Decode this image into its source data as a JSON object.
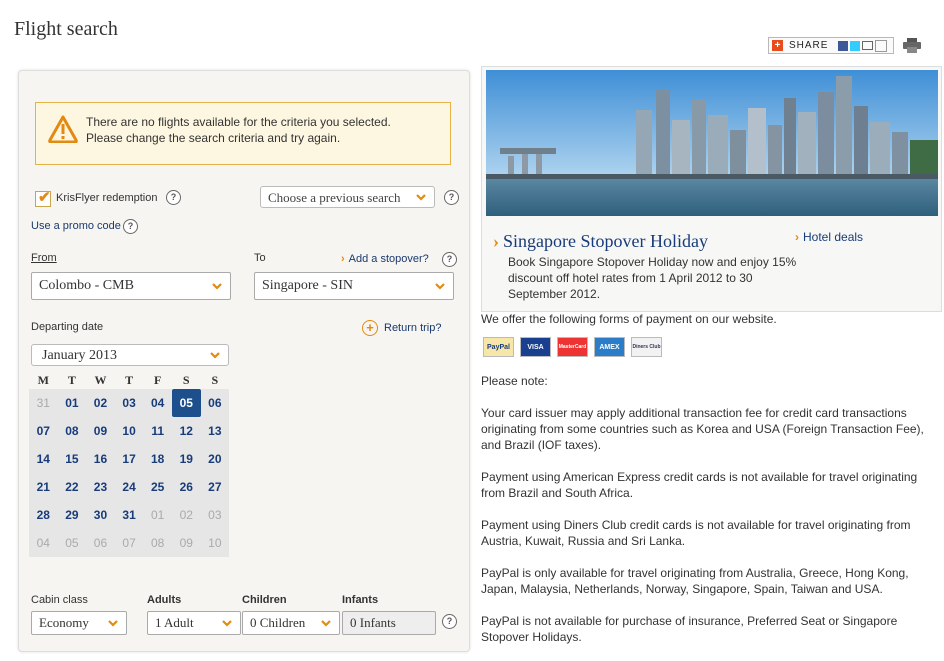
{
  "page": {
    "title": "Flight search"
  },
  "toolbar": {
    "share_label": "SHARE"
  },
  "alert": {
    "line1": "There are no flights available for the criteria you selected.",
    "line2": "Please change the search criteria and try again."
  },
  "search": {
    "krisflyer_label": "KrisFlyer redemption",
    "krisflyer_checked": true,
    "previous_search": "Choose a previous search",
    "promo_code_link": "Use a promo code",
    "from_label": "From",
    "from_value": "Colombo - CMB",
    "to_label": "To",
    "to_value": "Singapore - SIN",
    "stopover_link": "Add a stopover?",
    "departing_label": "Departing date",
    "return_trip_link": "Return trip?",
    "help_glyph": "?"
  },
  "calendar": {
    "month": "January 2013",
    "dow": [
      "M",
      "T",
      "W",
      "T",
      "F",
      "S",
      "S"
    ],
    "weeks": [
      [
        {
          "d": "31",
          "m": true
        },
        {
          "d": "01"
        },
        {
          "d": "02"
        },
        {
          "d": "03"
        },
        {
          "d": "04"
        },
        {
          "d": "05",
          "sel": true
        },
        {
          "d": "06"
        }
      ],
      [
        {
          "d": "07"
        },
        {
          "d": "08"
        },
        {
          "d": "09"
        },
        {
          "d": "10"
        },
        {
          "d": "11"
        },
        {
          "d": "12"
        },
        {
          "d": "13"
        }
      ],
      [
        {
          "d": "14"
        },
        {
          "d": "15"
        },
        {
          "d": "16"
        },
        {
          "d": "17"
        },
        {
          "d": "18"
        },
        {
          "d": "19"
        },
        {
          "d": "20"
        }
      ],
      [
        {
          "d": "21"
        },
        {
          "d": "22"
        },
        {
          "d": "23"
        },
        {
          "d": "24"
        },
        {
          "d": "25"
        },
        {
          "d": "26"
        },
        {
          "d": "27"
        }
      ],
      [
        {
          "d": "28"
        },
        {
          "d": "29"
        },
        {
          "d": "30"
        },
        {
          "d": "31"
        },
        {
          "d": "01",
          "m": true
        },
        {
          "d": "02",
          "m": true
        },
        {
          "d": "03",
          "m": true
        }
      ],
      [
        {
          "d": "04",
          "m": true
        },
        {
          "d": "05",
          "m": true
        },
        {
          "d": "06",
          "m": true
        },
        {
          "d": "07",
          "m": true
        },
        {
          "d": "08",
          "m": true
        },
        {
          "d": "09",
          "m": true
        },
        {
          "d": "10",
          "m": true
        }
      ]
    ]
  },
  "passengers": {
    "cabin_label": "Cabin class",
    "cabin_value": "Economy",
    "adults_label": "Adults",
    "adults_value": "1 Adult",
    "children_label": "Children",
    "children_value": "0 Children",
    "infants_label": "Infants",
    "infants_value": "0 Infants"
  },
  "promo": {
    "title": "Singapore Stopover Holiday",
    "desc": "Book Singapore Stopover Holiday now and enjoy 15% discount off hotel rates from 1 April 2012 to 30 September 2012.",
    "hotel_link": "Hotel deals"
  },
  "payment": {
    "intro": "We offer the following forms of payment on our website.",
    "cards": [
      "PayPal",
      "VISA",
      "MasterCard",
      "AMEX",
      "Diners Club"
    ],
    "notes": [
      "Please note:",
      "Your card issuer may apply additional transaction fee for credit card transactions originating from some countries such as Korea and USA (Foreign Transaction Fee), and Brazil (IOF taxes).",
      "Payment using American Express credit cards is not available for travel originating from Brazil and South Africa.",
      "Payment using Diners Club credit cards is not available for travel originating from Austria, Kuwait, Russia and Sri Lanka.",
      "PayPal is only available for travel originating from Australia, Greece, Hong Kong, Japan, Malaysia, Netherlands, Norway, Singapore, Spain, Taiwan and USA.",
      "PayPal is not available for purchase of insurance, Preferred Seat or Singapore Stopover Holidays."
    ]
  },
  "colors": {
    "accent": "#e28a12",
    "link": "#183c7a",
    "selected_day": "#1c4f8c"
  }
}
